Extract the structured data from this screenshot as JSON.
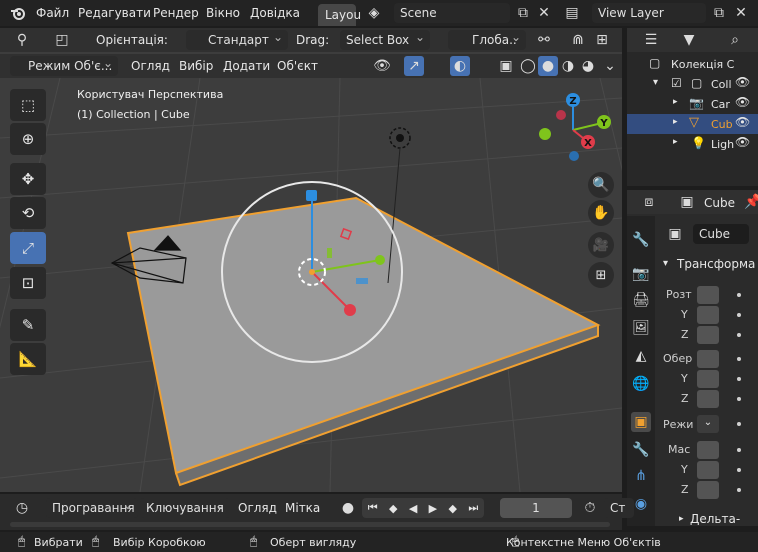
{
  "topbar": {
    "menus": [
      "Файл",
      "Редагувати",
      "Рендер",
      "Вікно",
      "Довідка"
    ],
    "workspace_tab": "Layou",
    "scene": "Scene",
    "view_layer": "View Layer"
  },
  "header": {
    "orientation_label": "Орієнтація:",
    "orientation_value": "Стандарт",
    "drag_label": "Drag:",
    "drag_value": "Select Box",
    "pivot_value": "Глоба..",
    "mode": "Режим Об'є...",
    "view_menu": "Огляд",
    "select_menu": "Вибір",
    "add_menu": "Додати",
    "object_menu": "Об'єкт"
  },
  "viewport": {
    "perspective": "Користувач Перспектива",
    "collection_info": "(1) Collection | Cube",
    "gizmo_axes": [
      "Z",
      "Y",
      "X"
    ]
  },
  "outliner": {
    "items": [
      {
        "label": "Колекція С"
      },
      {
        "label": "Coll"
      },
      {
        "label": "Car"
      },
      {
        "label": "Cub"
      },
      {
        "label": "Ligh"
      }
    ]
  },
  "properties": {
    "object_name": "Cube",
    "data_name": "Cube",
    "section_transform": "Трансформа",
    "location_label": "Розт",
    "rotation_label": "Обер",
    "mode_label": "Режи",
    "scale_label": "Мас",
    "axes": [
      "Y",
      "Z"
    ],
    "delta_section": "Дельта-тран"
  },
  "timeline": {
    "playback": "Програвання",
    "keying": "Ключування",
    "view": "Огляд",
    "marker": "Мітка",
    "current_frame": "1",
    "start_label": "Ст"
  },
  "statusbar": {
    "select": "Вибрати",
    "box_select": "Вибір Коробкою",
    "rotate_view": "Оберт вигляду",
    "context_menu": "Контекстне Меню Об'єктів"
  },
  "colors": {
    "accent": "#4772b3",
    "selection_orange": "#f0a030",
    "axis_x": "#e03c4a",
    "axis_y": "#7fc41c",
    "axis_z": "#2c8ee0"
  }
}
